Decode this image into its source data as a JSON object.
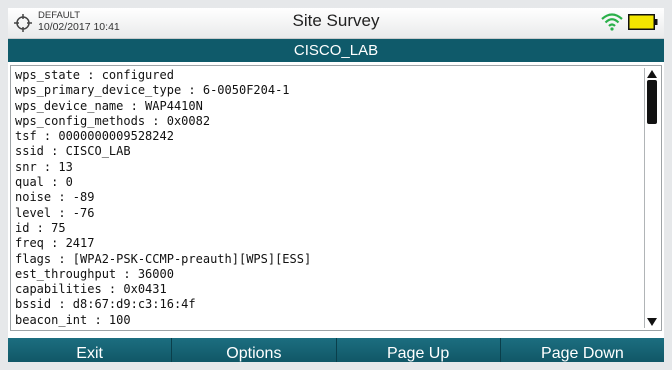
{
  "status_bar": {
    "profile_name": "DEFAULT",
    "datetime": "10/02/2017 10:41",
    "title": "Site Survey",
    "icons": [
      "location-target-icon",
      "wifi-icon",
      "battery-icon"
    ],
    "battery_color": "#f2e600"
  },
  "header": {
    "network_name": "CISCO_LAB",
    "color": "#0f5a6a"
  },
  "details": {
    "lines": [
      "wps_state : configured",
      "wps_primary_device_type : 6-0050F204-1",
      "wps_device_name : WAP4410N",
      "wps_config_methods : 0x0082",
      "tsf : 0000000009528242",
      "ssid : CISCO_LAB",
      "snr : 13",
      "qual : 0",
      "noise : -89",
      "level : -76",
      "id : 75",
      "freq : 2417",
      "flags : [WPA2-PSK-CCMP-preauth][WPS][ESS]",
      "est_throughput : 36000",
      "capabilities : 0x0431",
      "bssid : d8:67:d9:c3:16:4f",
      "beacon_int : 100"
    ]
  },
  "softkeys": {
    "exit": "Exit",
    "options": "Options",
    "page_up": "Page Up",
    "page_down": "Page Down"
  }
}
